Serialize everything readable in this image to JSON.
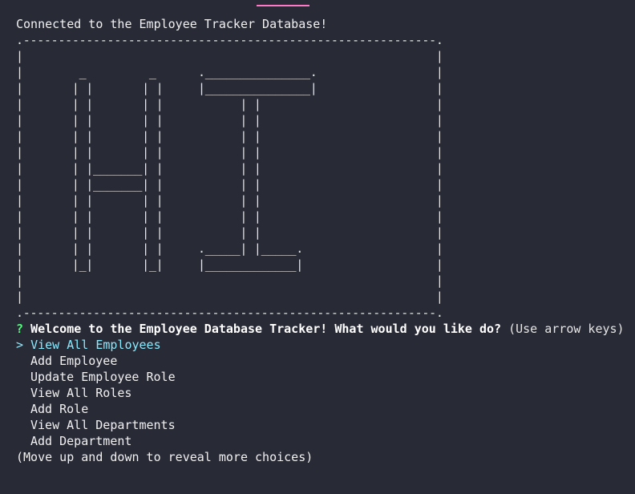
{
  "header": {
    "connection_message": "Connected to the Employee Tracker Database!"
  },
  "banner": {
    "art": ".-----------------------------------------------------------.\n|                                                           |\n|        _         _      ._______________.                 |\n|       | |       | |     |_______________|                 |\n|       | |       | |           | |                         |\n|       | |       | |           | |                         |\n|       | |       | |           | |                         |\n|       | |       | |           | |                         |\n|       | |_______| |           | |                         |\n|       | |_______| |           | |                         |\n|       | |       | |           | |                         |\n|       | |       | |           | |                         |\n|       | |       | |           | |                         |\n|       | |       | |     ._____| |_____.                   |\n|       |_|       |_|     |_____________|                   |\n|                                                           |\n|                                                           |\n.-----------------------------------------------------------."
  },
  "prompt": {
    "mark": "?",
    "question": "Welcome to the Employee Database Tracker! What would you like do?",
    "hint": "(Use arrow keys)",
    "pointer": ">",
    "choices": [
      "View All Employees",
      "Add Employee",
      "Update Employee Role",
      "View All Roles",
      "Add Role",
      "View All Departments",
      "Add Department"
    ],
    "footer": "(Move up and down to reveal more choices)"
  },
  "colors": {
    "background": "#282a36",
    "prompt_mark": "#50fa7b",
    "selected": "#8be9fd",
    "accent": "#ff79c6"
  }
}
